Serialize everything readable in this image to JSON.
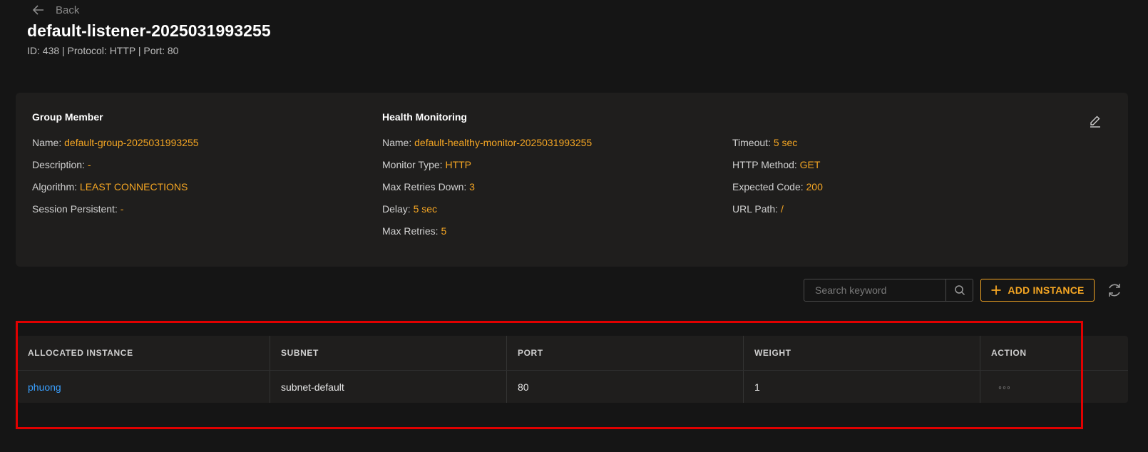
{
  "header": {
    "back_label": "Back",
    "title": "default-listener-2025031993255",
    "subtitle": "ID: 438 | Protocol: HTTP | Port: 80"
  },
  "group_member": {
    "heading": "Group Member",
    "rows": [
      {
        "label": "Name:",
        "value": "default-group-2025031993255"
      },
      {
        "label": "Description:",
        "value": "-"
      },
      {
        "label": "Algorithm:",
        "value": "LEAST CONNECTIONS"
      },
      {
        "label": "Session Persistent:",
        "value": "-"
      }
    ]
  },
  "health_monitoring": {
    "heading": "Health Monitoring",
    "rows_left": [
      {
        "label": "Name:",
        "value": "default-healthy-monitor-2025031993255"
      },
      {
        "label": "Monitor Type:",
        "value": "HTTP"
      },
      {
        "label": "Max Retries Down:",
        "value": "3"
      },
      {
        "label": "Delay:",
        "value": "5 sec"
      },
      {
        "label": "Max Retries:",
        "value": "5"
      }
    ],
    "rows_right": [
      {
        "label": "Timeout:",
        "value": "5 sec"
      },
      {
        "label": "HTTP Method:",
        "value": "GET"
      },
      {
        "label": "Expected Code:",
        "value": "200"
      },
      {
        "label": "URL Path:",
        "value": "/"
      }
    ]
  },
  "toolbar": {
    "search_placeholder": "Search keyword",
    "add_label": "ADD INSTANCE"
  },
  "table": {
    "columns": [
      "ALLOCATED INSTANCE",
      "SUBNET",
      "PORT",
      "WEIGHT",
      "ACTION"
    ],
    "rows": [
      {
        "instance": "phuong",
        "subnet": "subnet-default",
        "port": "80",
        "weight": "1",
        "action": "◦◦◦"
      }
    ]
  },
  "colors": {
    "accent": "#f5a623",
    "link": "#3aa0ff",
    "background": "#151515",
    "panel": "#1f1e1d",
    "highlight": "#e00000"
  },
  "icons": [
    "arrow-left-icon",
    "edit-icon",
    "search-icon",
    "plus-icon",
    "refresh-icon",
    "more-icon"
  ]
}
